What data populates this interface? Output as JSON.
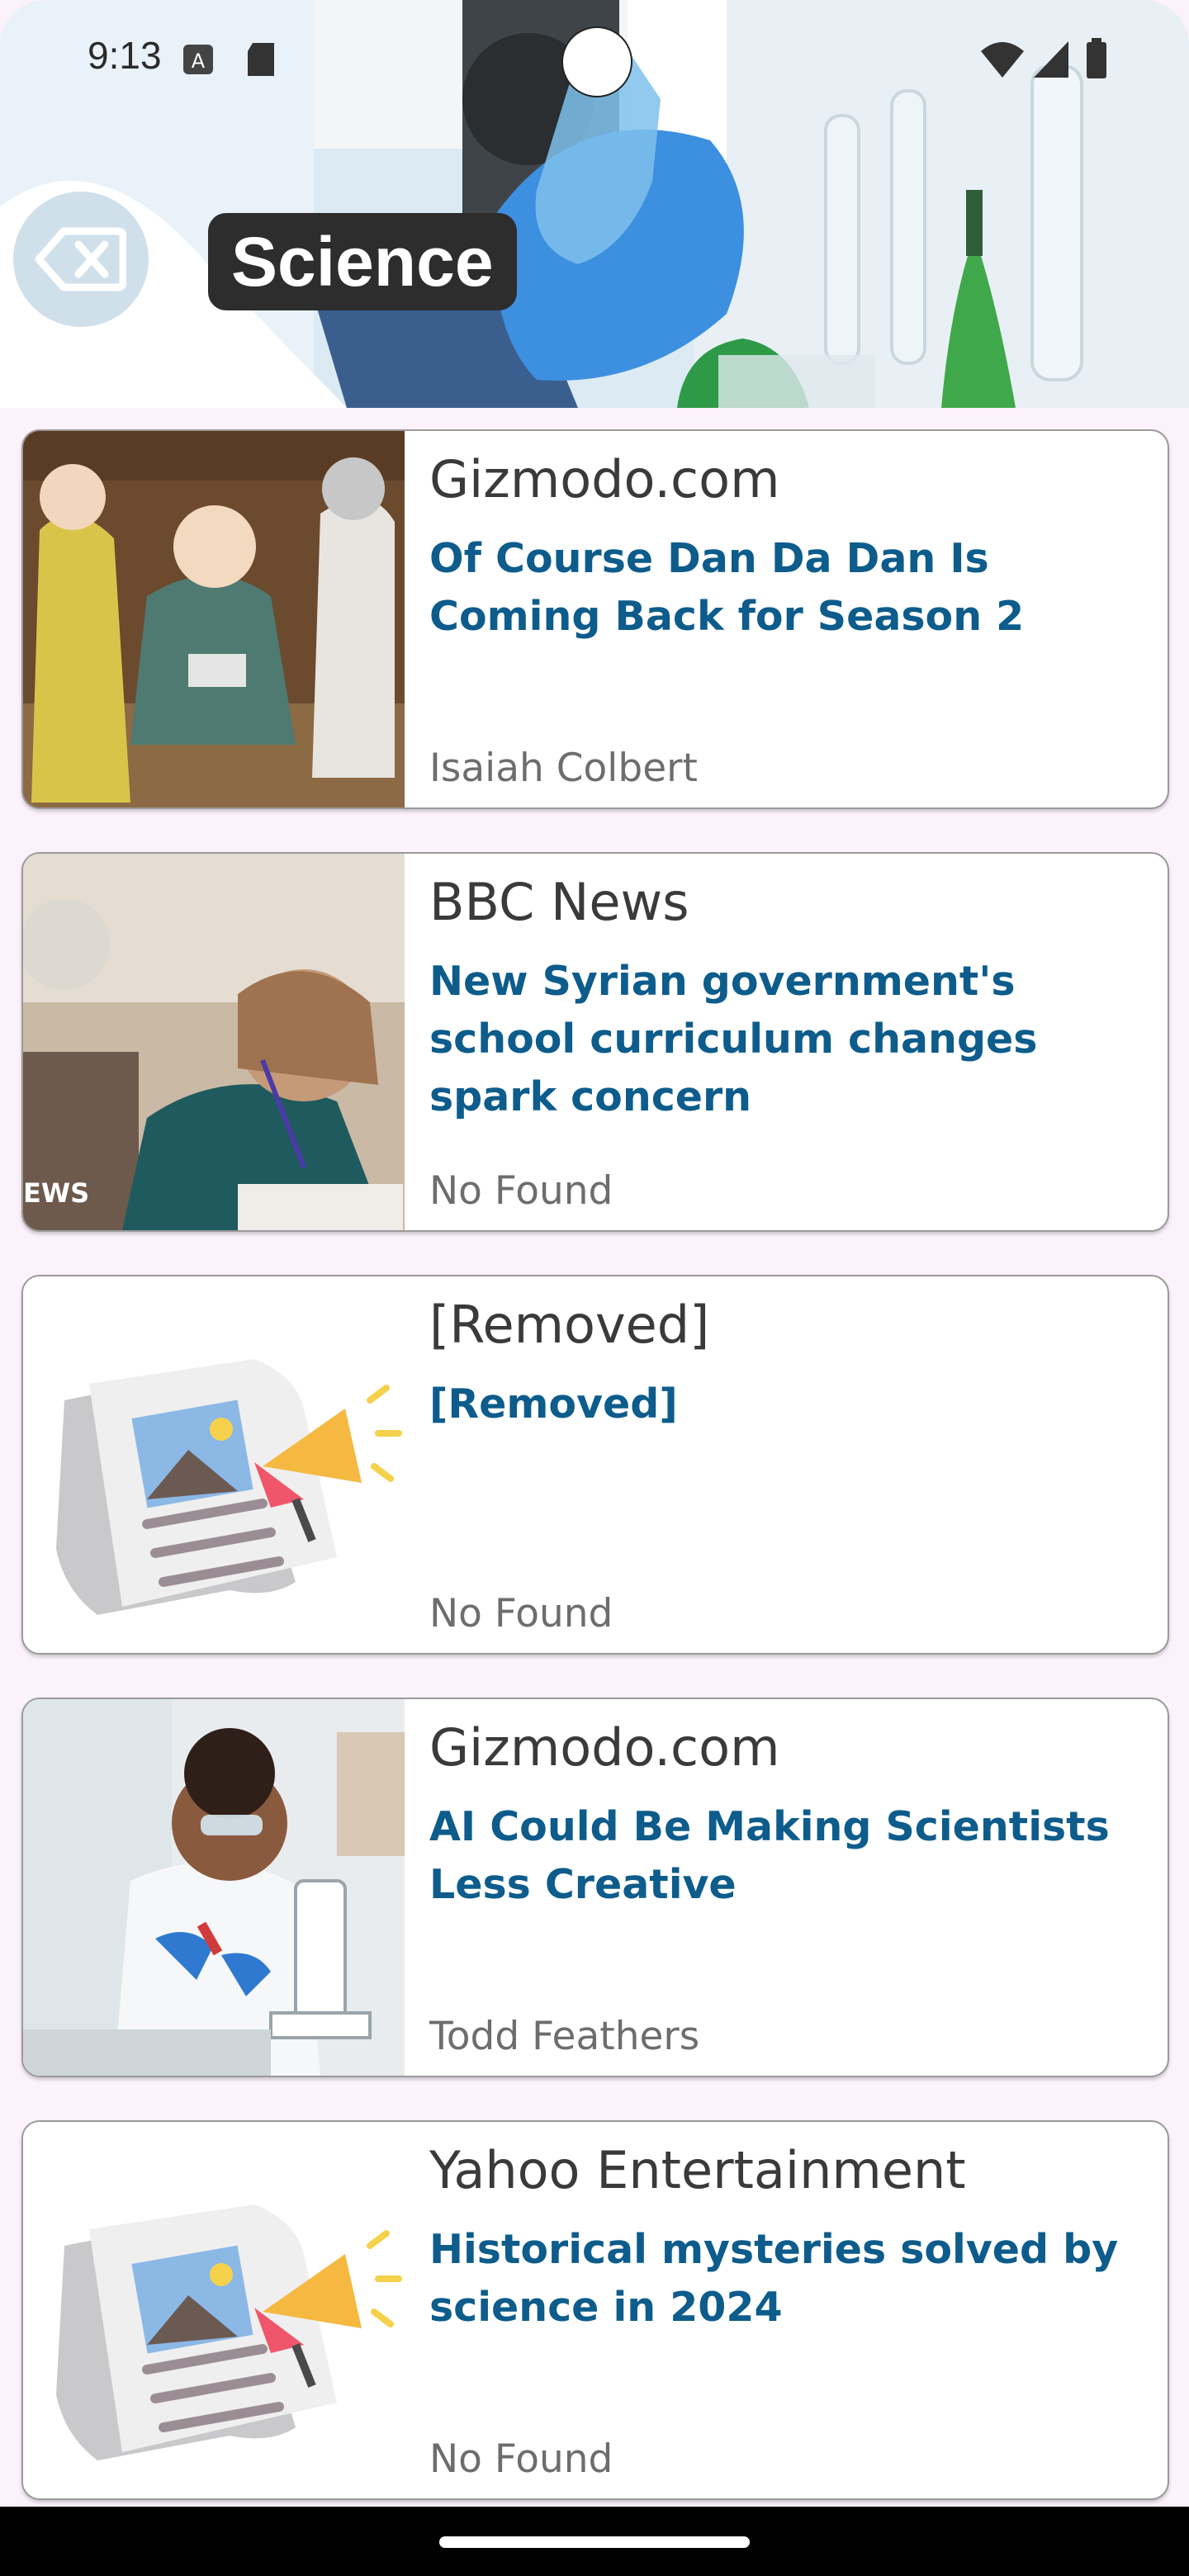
{
  "status": {
    "time": "9:13"
  },
  "header": {
    "title": "Science"
  },
  "articles": [
    {
      "source": "Gizmodo.com",
      "title": "Of Course Dan Da Dan Is Coming Back for Season 2",
      "author": "Isaiah Colbert",
      "thumb": "anime-scene"
    },
    {
      "source": "BBC News",
      "title": "New Syrian government's school curriculum changes spark concern",
      "author": "No Found",
      "thumb": "classroom-photo",
      "thumb_caption": "EWS"
    },
    {
      "source": "[Removed]",
      "title": "[Removed]",
      "author": "No Found",
      "thumb": "newspaper-placeholder"
    },
    {
      "source": "Gizmodo.com",
      "title": "AI Could Be Making Scientists Less Creative",
      "author": "Todd Feathers",
      "thumb": "lab-photo"
    },
    {
      "source": "Yahoo Entertainment",
      "title": "Historical mysteries solved by science in 2024",
      "author": "No Found",
      "thumb": "newspaper-placeholder"
    }
  ],
  "colors": {
    "headline": "#0d5c8c",
    "background": "#fbf2fb"
  }
}
